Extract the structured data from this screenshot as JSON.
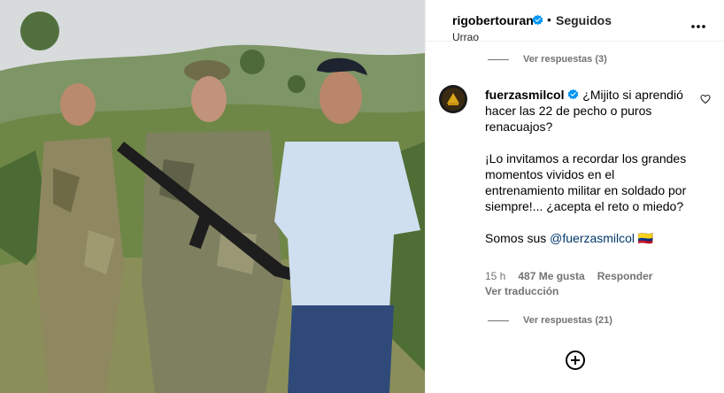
{
  "post": {
    "username": "rigobertouran",
    "separator": "•",
    "follow_status": "Seguidos",
    "location": "Urrao"
  },
  "thread": {
    "replies_top_label": "Ver respuestas (3)",
    "comment": {
      "username": "fuerzasmilcol",
      "text": "¿Mijito si aprendió hacer las 22 de pecho o puros renacuajos?\n\n¡Lo invitamos a recordar los grandes momentos vividos en el entrenamiento militar en soldado por siempre!... ¿acepta el reto o miedo?\n\nSomos sus ",
      "mention": "@fuerzasmilcol",
      "emoji": " 🇨🇴",
      "time": "15 h",
      "likes": "487 Me gusta",
      "reply_label": "Responder",
      "translate_label": "Ver traducción",
      "replies_label": "Ver respuestas (21)"
    }
  },
  "colors": {
    "verified": "#0095f6",
    "secondary_text": "#737373",
    "mention": "#00376b"
  },
  "icons": {
    "verified": "verified-badge-icon",
    "more": "more-options-icon",
    "heart": "heart-icon",
    "add": "add-circle-icon"
  }
}
